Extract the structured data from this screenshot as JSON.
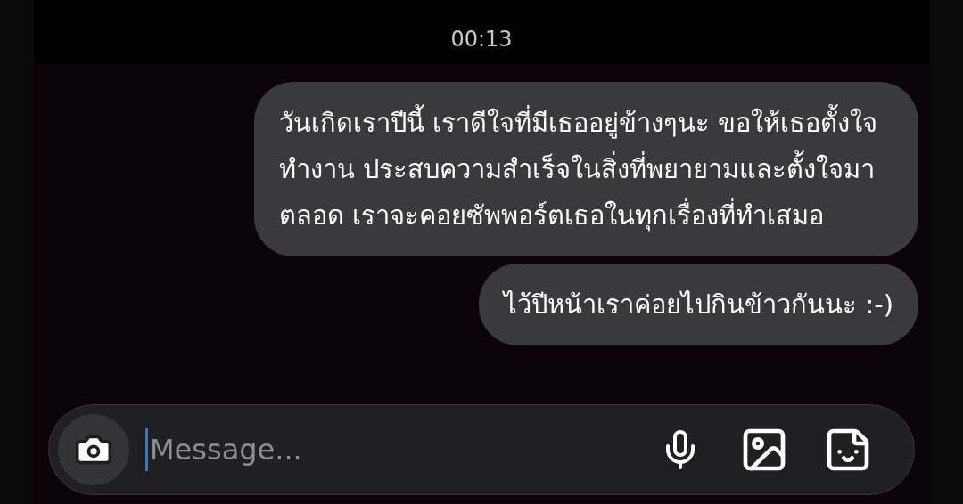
{
  "timestamp": "00:13",
  "messages": [
    {
      "text": "วันเกิดเราปีนี้ เราดีใจที่มีเธออยู่ข้างๆนะ ขอให้เธอตั้งใจทำงาน ประสบความสำเร็จในสิ่งที่พยายามและตั้งใจมาตลอด เราจะคอยซัพพอร์ตเธอในทุกเรื่องที่ทำเสมอ"
    },
    {
      "text": "ไว้ปีหน้าเราค่อยไปกินข้าวกันนะ :-)"
    }
  ],
  "composer": {
    "placeholder": "Message..."
  }
}
